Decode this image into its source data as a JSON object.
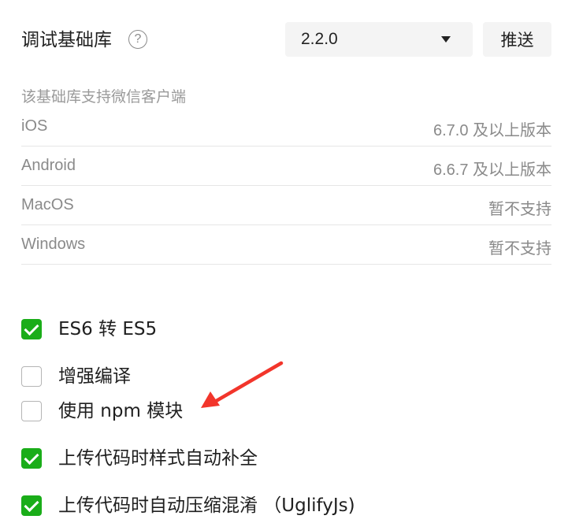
{
  "header": {
    "title": "调试基础库",
    "help_glyph": "?",
    "version_selected": "2.2.0",
    "push_label": "推送"
  },
  "support": {
    "note": "该基础库支持微信客户端",
    "platforms": [
      {
        "name": "iOS",
        "version": "6.7.0 及以上版本"
      },
      {
        "name": "Android",
        "version": "6.6.7 及以上版本"
      },
      {
        "name": "MacOS",
        "version": "暂不支持"
      },
      {
        "name": "Windows",
        "version": "暂不支持"
      }
    ]
  },
  "options": [
    {
      "label": "ES6 转 ES5",
      "checked": true
    },
    {
      "label": "增强编译",
      "checked": false
    },
    {
      "label": "使用 npm 模块",
      "checked": false
    },
    {
      "label": "上传代码时样式自动补全",
      "checked": true
    },
    {
      "label": "上传代码时自动压缩混淆 （UglifyJs)",
      "checked": true
    }
  ],
  "colors": {
    "checkbox_checked": "#1aad19",
    "annotation_arrow": "#f2352b"
  }
}
